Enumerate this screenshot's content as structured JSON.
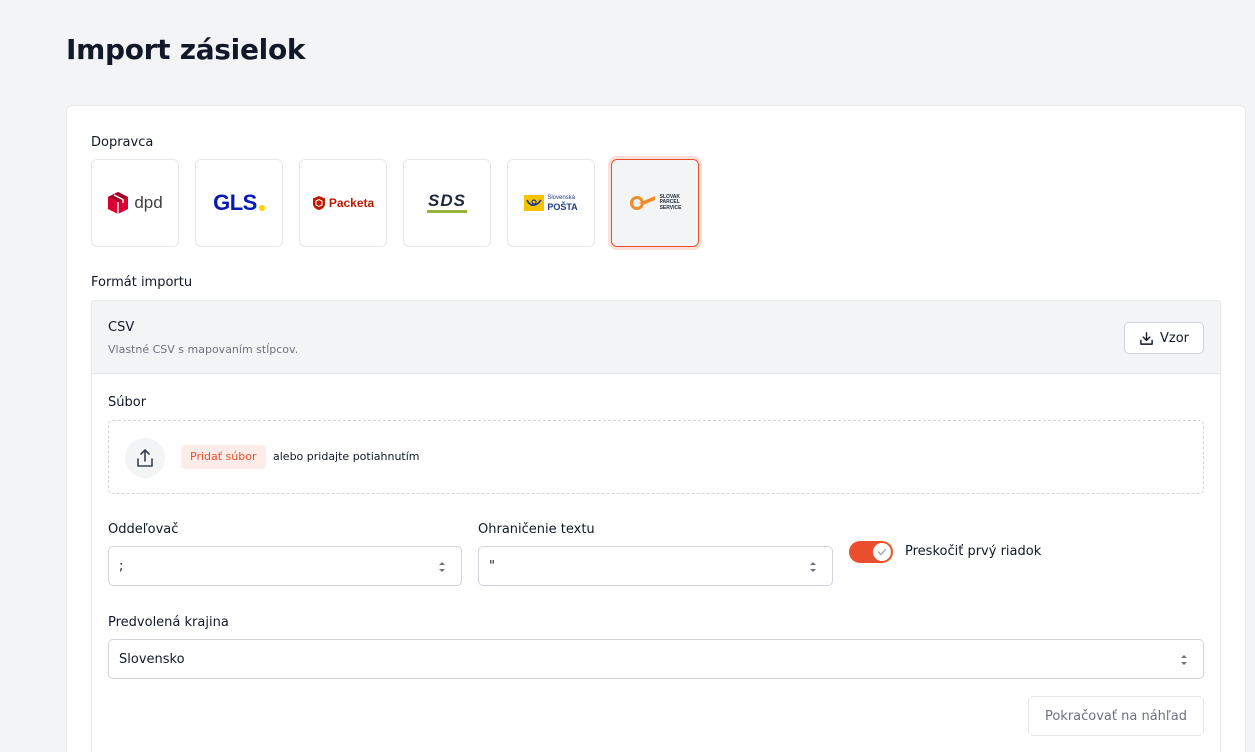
{
  "page": {
    "title": "Import zásielok"
  },
  "carrier_section": {
    "label": "Dopravca",
    "carriers": [
      {
        "name": "dpd",
        "logo_text": "dpd",
        "color": "#dc0032",
        "selected": false
      },
      {
        "name": "gls",
        "logo_text": "GLS",
        "color": "#061ab1",
        "dot_color": "#ffd100",
        "selected": false
      },
      {
        "name": "packeta",
        "logo_text": "Packeta",
        "color": "#ba1b02",
        "selected": false
      },
      {
        "name": "sds",
        "logo_text": "SDS",
        "color": "#1f2937",
        "selected": false
      },
      {
        "name": "slovenska-posta",
        "logo_text_small": "Slovenská",
        "logo_text": "POŠTA",
        "color": "#1e3a8a",
        "selected": false
      },
      {
        "name": "sps",
        "logo_lines": [
          "SLOVAK",
          "PARCEL",
          "SERVICE"
        ],
        "color": "#f28c28",
        "selected": true
      }
    ]
  },
  "format_section": {
    "label": "Formát importu",
    "format_name": "CSV",
    "format_desc": "Vlastné CSV s mapovaním stĺpcov.",
    "sample_button": "Vzor"
  },
  "file_section": {
    "label": "Súbor",
    "add_file": "Pridať súbor",
    "drop_text": "alebo pridajte potiahnutím"
  },
  "separator": {
    "label": "Oddeľovač",
    "value": ";"
  },
  "text_qualifier": {
    "label": "Ohraničenie textu",
    "value": "\""
  },
  "skip_first_row": {
    "label": "Preskočiť prvý riadok",
    "checked": true
  },
  "default_country": {
    "label": "Predvolená krajina",
    "value": "Slovensko"
  },
  "continue_button": "Pokračovať na náhľad",
  "colors": {
    "accent": "#ea4f2d",
    "accent_light": "#fdecea",
    "border": "#e5e7eb",
    "bg": "#f3f4f6"
  }
}
